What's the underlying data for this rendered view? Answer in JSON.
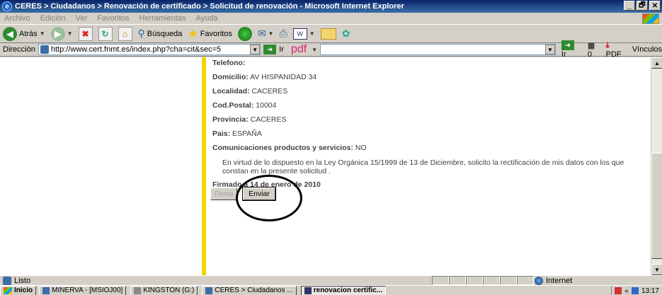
{
  "window": {
    "title": "CERES > Ciudadanos > Renovación de certificado > Solicitud de renovación - Microsoft Internet Explorer",
    "controls": [
      "_",
      "🗗",
      "✕"
    ]
  },
  "menu": [
    "Archivo",
    "Edición",
    "Ver",
    "Favoritos",
    "Herramientas",
    "Ayuda"
  ],
  "toolbar": {
    "back_label": "Atrás",
    "search_label": "Búsqueda",
    "favorites_label": "Favoritos"
  },
  "address": {
    "label": "Dirección",
    "url": "http://www.cert.fnmt.es/index.php?cha=cit&sec=5",
    "go_label": "Ir",
    "pdf_logo": "pdf",
    "go2_label": "Ir",
    "count": "0",
    "pdf_label": "PDF",
    "links_label": "Vínculos"
  },
  "form": {
    "telefono_label": "Telefono:",
    "telefono_value": "",
    "domicilio_label": "Domicilio:",
    "domicilio_value": "AV HISPANIDAD 34",
    "localidad_label": "Localidad:",
    "localidad_value": "CACERES",
    "cp_label": "Cod.Postal:",
    "cp_value": "10004",
    "provincia_label": "Provincia:",
    "provincia_value": "CACERES",
    "pais_label": "Pais:",
    "pais_value": "ESPAÑA",
    "comunicaciones_label": "Comunicaciones productos y servicios:",
    "comunicaciones_value": "NO",
    "legal_text": "En virtud de lo dispuesto en la Ley Orgánica 15/1999 de 13 de Diciembre, solicito la rectificación de mis datos con los que constan en la presente solicitud .",
    "firmado": "Firmado a 14 de enero de 2010",
    "firma_button": "Firma",
    "enviar_button": "Enviar"
  },
  "status": {
    "text": "Listo",
    "zone": "Internet"
  },
  "taskbar": {
    "start": "Inicio",
    "tasks": [
      "MINERVA - [MSIOJ00]",
      "KINGSTON (G:)",
      "CERES > Ciudadanos ...",
      "renovacion certific..."
    ],
    "clock": "13:17"
  }
}
